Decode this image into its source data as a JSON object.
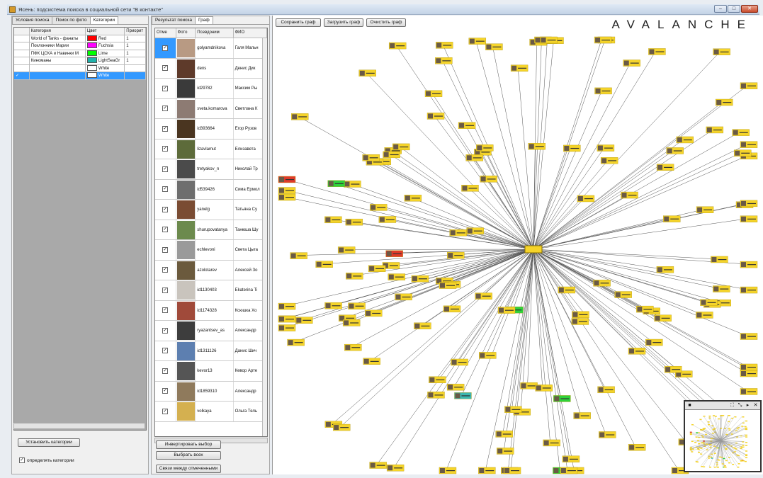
{
  "window": {
    "title": "Ясень: подсистема поиска в социальной сети \"В контакте\"",
    "min_label": "–",
    "max_label": "□",
    "close_label": "✕"
  },
  "left_panel": {
    "tabs": [
      "Условия поиска",
      "Поиск по фото",
      "Категории"
    ],
    "columns": [
      "",
      "Категория",
      "Цвет",
      "Приорит"
    ],
    "rows": [
      {
        "mark": "",
        "name": "World of Tanks - фанаты",
        "color_name": "Red",
        "color": "#ff0000",
        "priority": "1"
      },
      {
        "mark": "",
        "name": "Поклонники Марии",
        "color_name": "Fuchsia",
        "color": "#ff00ff",
        "priority": "1"
      },
      {
        "mark": "",
        "name": "ПФК ЦСКА и Навинки М",
        "color_name": "Lime",
        "color": "#00ff00",
        "priority": "1"
      },
      {
        "mark": "",
        "name": "Киноманы",
        "color_name": "LightSeaGr",
        "color": "#20b2aa",
        "priority": "1"
      },
      {
        "mark": "",
        "name": "",
        "color_name": "White",
        "color": "#ffffff",
        "priority": ""
      },
      {
        "mark": "✓",
        "name": "",
        "color_name": "White",
        "color": "#ffffff",
        "priority": ""
      }
    ],
    "set_categories_button": "Установить категории",
    "detect_checkbox_label": "определять категории",
    "detect_checked": true
  },
  "mid_panel": {
    "tabs": [
      "Результат поиска",
      "Граф"
    ],
    "columns": [
      "Отме",
      "Фото",
      "Псевдоним",
      "ФИО"
    ],
    "rows": [
      {
        "nick": "golyamdnikova",
        "fio": "Галя Мальн",
        "photo": "#b89a83"
      },
      {
        "nick": "dens",
        "fio": "Денис Дик",
        "photo": "#5e3a2a"
      },
      {
        "nick": "id29782",
        "fio": "Максим Ры",
        "photo": "#3a3a3a"
      },
      {
        "nick": "sveta.komarova",
        "fio": "Светлана К",
        "photo": "#8d7b73"
      },
      {
        "nick": "id393664",
        "fio": "Егор Рузов",
        "photo": "#4a3520"
      },
      {
        "nick": "lizavlamut",
        "fio": "Елизавета",
        "photo": "#5d6b3a"
      },
      {
        "nick": "tretyakov_n",
        "fio": "Николай Тр",
        "photo": "#4b4b4b"
      },
      {
        "nick": "id539426",
        "fio": "Сима Ермол",
        "photo": "#6e6e6e"
      },
      {
        "nick": "yanelg",
        "fio": "Татьяна Су",
        "photo": "#7a4c33"
      },
      {
        "nick": "shurupovatanya",
        "fio": "Танюша Шу",
        "photo": "#6c8a4d"
      },
      {
        "nick": "echlevoni",
        "fio": "Света Цыга",
        "photo": "#9a9a9a"
      },
      {
        "nick": "azolotarev",
        "fio": "Алексей Зо",
        "photo": "#6b5a3d"
      },
      {
        "nick": "id1130403",
        "fio": "Ekaterina Ti",
        "photo": "#c9c4bd"
      },
      {
        "nick": "id1174328",
        "fio": "Ксюшка Хо",
        "photo": "#a04a3a"
      },
      {
        "nick": "ryazantsev_as",
        "fio": "Александр",
        "photo": "#3d3d3d"
      },
      {
        "nick": "id1311126",
        "fio": "Данис Шич",
        "photo": "#5d7fb0"
      },
      {
        "nick": "kevor13",
        "fio": "Кевор Арте",
        "photo": "#555555"
      },
      {
        "nick": "id1859310",
        "fio": "Александр",
        "photo": "#8f7a5c"
      },
      {
        "nick": "volkaya",
        "fio": "Ольга Тель",
        "photo": "#d4b050"
      }
    ],
    "invert_button": "Инвертировать выбор",
    "select_all_button": "Выбрать всех",
    "links_button": "Связи между отмеченными"
  },
  "graph": {
    "save_button": "Сохранить граф",
    "load_button": "Загрузить граф",
    "clear_button": "Очистить граф",
    "brand": "AVALANCHE",
    "node_color": "#f5d42a",
    "minimap_pin": "■"
  }
}
